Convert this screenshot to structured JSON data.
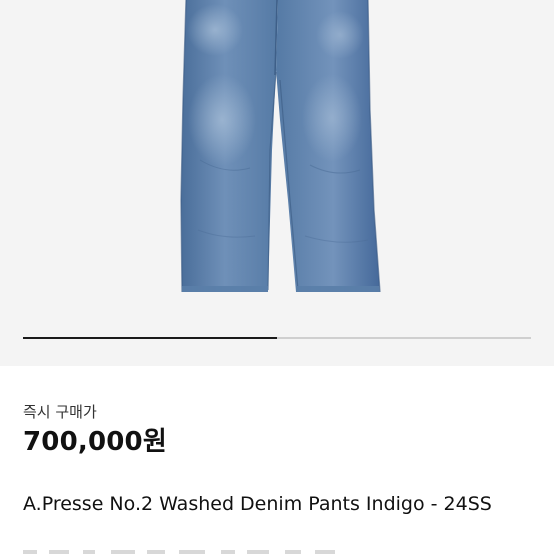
{
  "gallery": {
    "image_alt": "washed denim pants",
    "progress": 0.5,
    "colors": {
      "background": "#f4f4f4",
      "track": "#cfcfcf",
      "fill": "#1a1a1a"
    }
  },
  "listing": {
    "buy_label": "즉시 구매가",
    "price": "700,000원",
    "title": "A.Presse No.2 Washed Denim Pants Indigo - 24SS"
  }
}
